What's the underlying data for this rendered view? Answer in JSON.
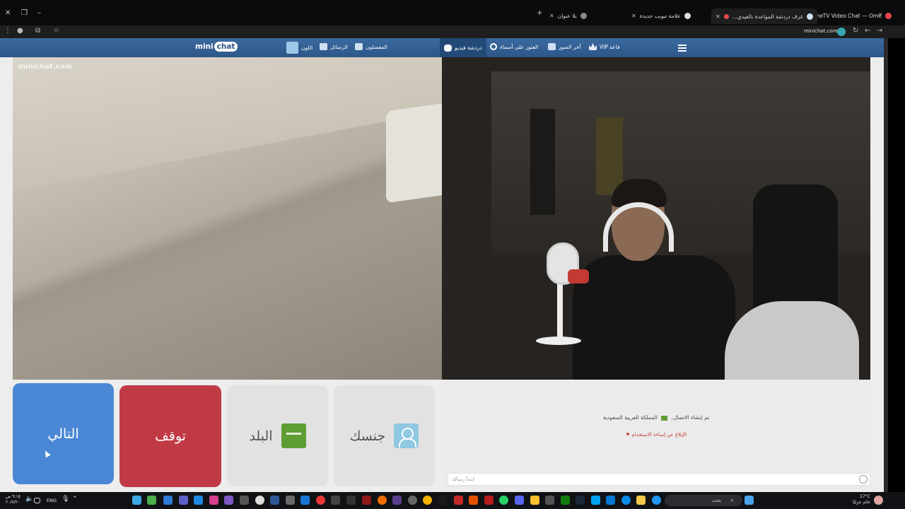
{
  "browser": {
    "tabs": [
      {
        "title": "OmeTV Video Chat — Ome...",
        "active": false
      },
      {
        "title": "غرف دردشة المواعدة بالفيدي...",
        "active": true
      },
      {
        "title": "علامة تبويب جديدة",
        "active": false
      },
      {
        "title": "بلا عنوان",
        "active": false
      }
    ],
    "new_tab": "+",
    "url": "minichat.com"
  },
  "site": {
    "logo": {
      "prefix": "mini",
      "bubble": "chat"
    },
    "watermark": "minichat.com",
    "nav": {
      "vip": "VIP قاعة",
      "latest_photos": "آخر الصور",
      "search_name": "العثور على أسماء",
      "video_chat": "دردشة فيديو",
      "favorites": "المفضلون",
      "messages": "الرسائل",
      "color": "اللون"
    },
    "controls": {
      "next": "التالي",
      "stop": "توقف",
      "country": "البلد",
      "gender": "جنسك"
    },
    "chat": {
      "status_connected": "تم إنشاء الاتصال.",
      "status_country": "المملكة العربية السعودية",
      "report": "الإبلاغ عن إساءة الاستخدام",
      "input_placeholder": "ابتدأ رسالة"
    }
  },
  "taskbar": {
    "time": "٩:١٥ ص",
    "date": "٢٠/٧/٢٠",
    "lang": "ENG",
    "search": "بحث",
    "weather_temp": "17°C",
    "weather_desc": "غائم جزئيًا"
  },
  "colors": {
    "nav": "#2d5688",
    "next": "#4a88d6",
    "stop": "#c03a45",
    "country_flag": "#5e9d34",
    "gender_icon": "#8fc8e0"
  }
}
